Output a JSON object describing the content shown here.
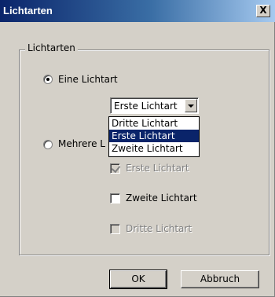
{
  "window": {
    "title": "Lichtarten",
    "close_label": "X"
  },
  "group": {
    "label": "Lichtarten"
  },
  "radios": {
    "single_label": "Eine Lichtart",
    "single_checked": true,
    "multiple_label": "Mehrere L",
    "multiple_checked": false
  },
  "combo": {
    "value": "Erste Lichtart",
    "options": [
      "Dritte Lichtart",
      "Erste Lichtart",
      "Zweite Lichtart"
    ],
    "highlighted_option": "Erste Lichtart"
  },
  "checkboxes": [
    {
      "label": "Erste Lichtart",
      "checked": true,
      "enabled": false
    },
    {
      "label": "Zweite Lichtart",
      "checked": false,
      "enabled": true
    },
    {
      "label": "Dritte Lichtart",
      "checked": false,
      "enabled": false
    }
  ],
  "buttons": {
    "ok_label": "OK",
    "cancel_label": "Abbruch"
  }
}
